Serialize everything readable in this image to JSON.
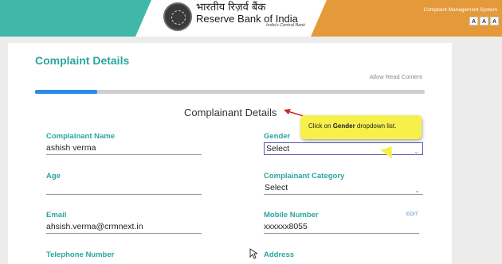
{
  "header": {
    "org_hindi": "भारतीय रिज़र्व बैंक",
    "org_english": "Reserve Bank of India",
    "tagline": "India's Central Bank",
    "system_title": "Complaint Management System",
    "font_size_buttons": [
      "A",
      "A",
      "A"
    ],
    "colors": {
      "teal": "#3fb7a9",
      "orange": "#e49a3b"
    }
  },
  "page": {
    "title": "Complaint Details",
    "read_link": "Allow Read Content",
    "progress": 0.16,
    "section_title": "Complainant Details"
  },
  "fields": {
    "name": {
      "label": "Complainant Name",
      "value": "ashish verma"
    },
    "gender": {
      "label": "Gender",
      "value": "Select"
    },
    "age": {
      "label": "Age",
      "value": ""
    },
    "category": {
      "label": "Complainant Category",
      "value": "Select"
    },
    "email": {
      "label": "Email",
      "value": "ahsish.verma@crmnext.in"
    },
    "mobile": {
      "label": "Mobile Number",
      "value": "xxxxxx8055",
      "edit": "EDIT"
    },
    "telephone": {
      "label": "Telephone Number"
    },
    "address": {
      "label": "Address"
    }
  },
  "tooltip": {
    "prefix": "Click on ",
    "bold": "Gender",
    "suffix": " dropdown list."
  }
}
